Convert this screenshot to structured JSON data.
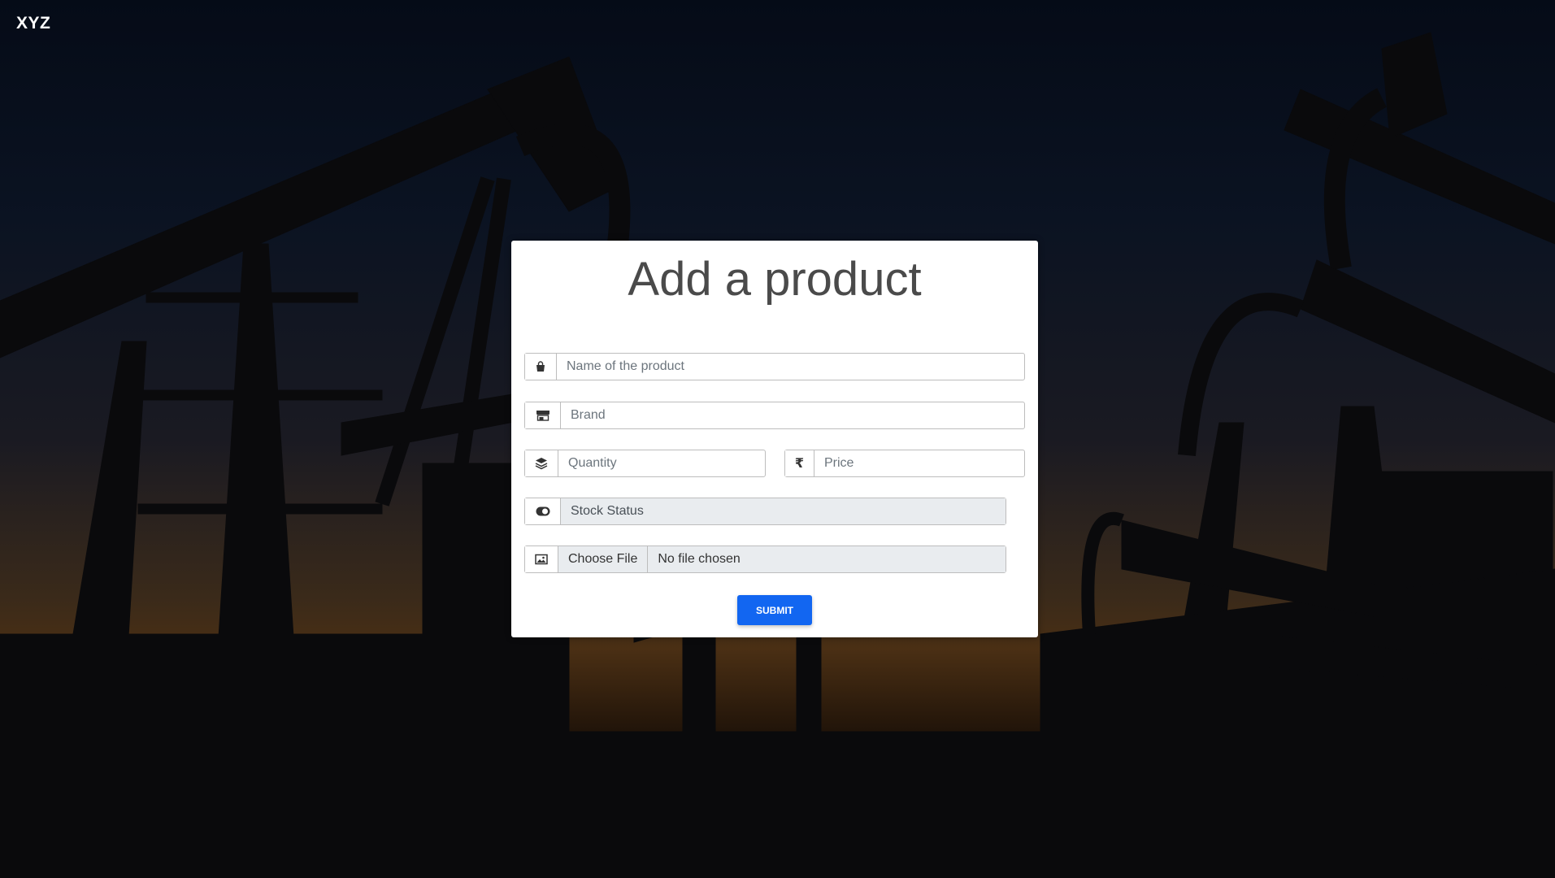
{
  "brand": "XYZ",
  "form": {
    "title": "Add a product",
    "name_placeholder": "Name of the product",
    "brand_placeholder": "Brand",
    "quantity_placeholder": "Quantity",
    "price_placeholder": "Price",
    "stock_status_value": "Stock Status",
    "file_button_label": "Choose File",
    "file_status": "No file chosen",
    "submit_label": "SUBMIT"
  },
  "icons": {
    "name": "shopping-bag-icon",
    "brand": "store-icon",
    "quantity": "layers-icon",
    "price": "rupee-icon",
    "stock": "toggle-icon",
    "image": "image-icon"
  },
  "colors": {
    "accent": "#1266f1",
    "card": "#ffffff",
    "brand_text": "#ffffff"
  }
}
